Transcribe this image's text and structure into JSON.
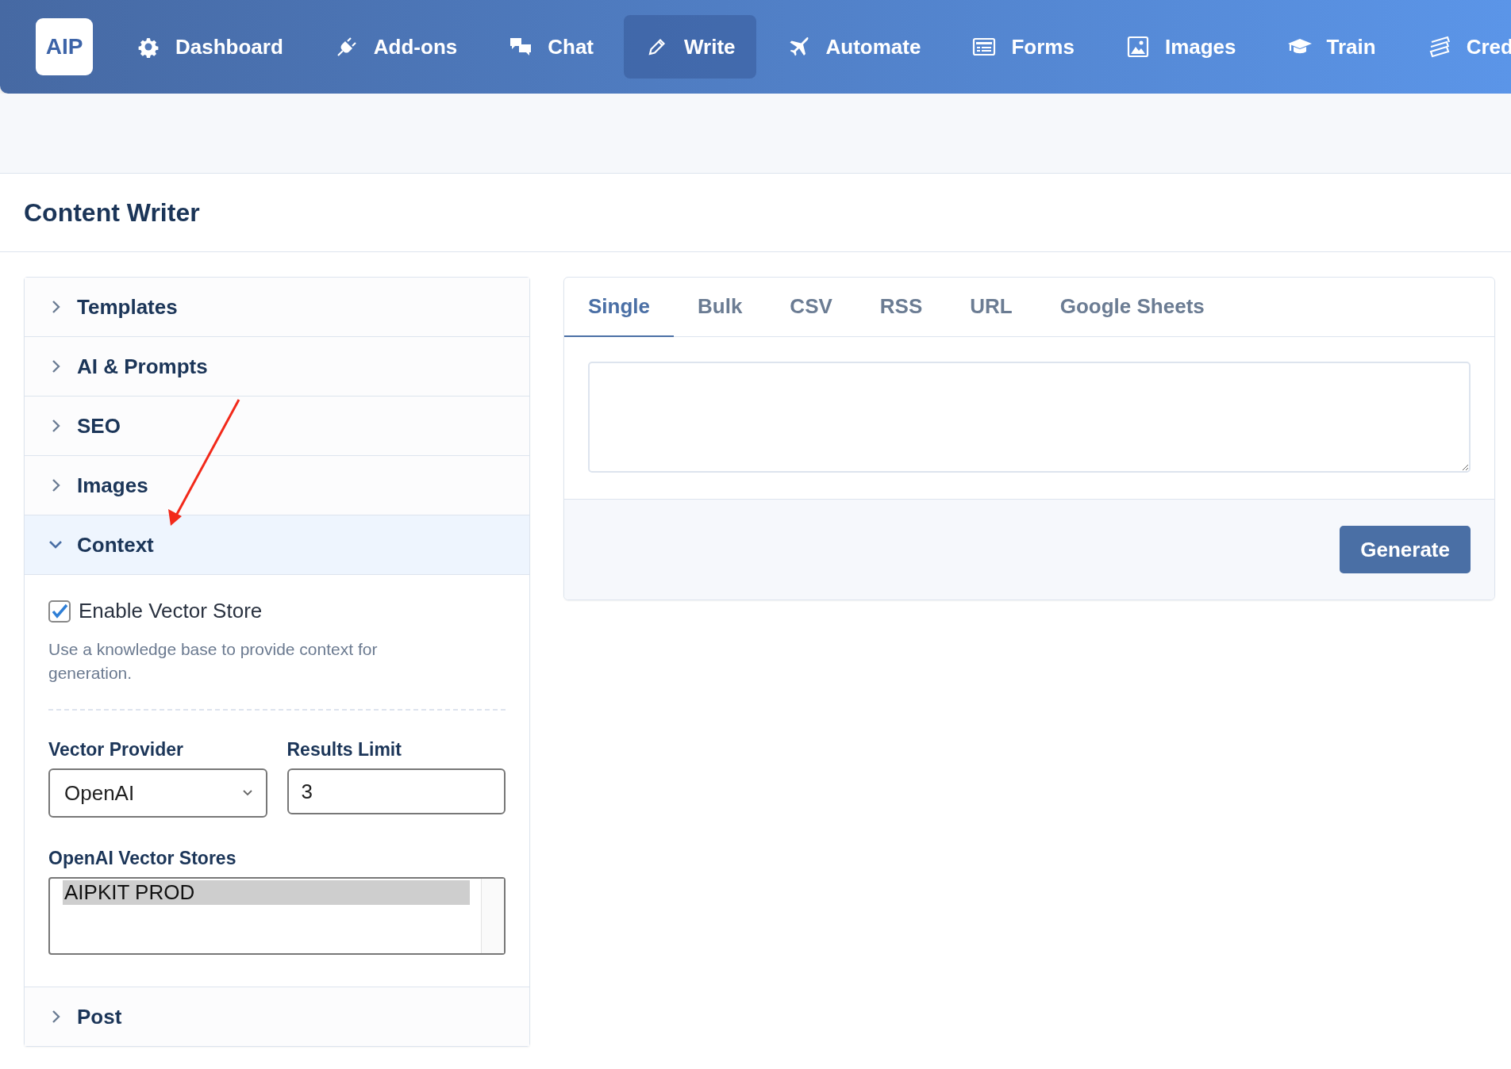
{
  "nav": {
    "logo": "AIP",
    "items": [
      {
        "label": "Dashboard",
        "selected": false
      },
      {
        "label": "Add-ons",
        "selected": false
      },
      {
        "label": "Chat",
        "selected": false
      },
      {
        "label": "Write",
        "selected": true
      },
      {
        "label": "Automate",
        "selected": false
      },
      {
        "label": "Forms",
        "selected": false
      },
      {
        "label": "Images",
        "selected": false
      },
      {
        "label": "Train",
        "selected": false
      },
      {
        "label": "Cred",
        "selected": false
      }
    ]
  },
  "page_title": "Content Writer",
  "accordion": [
    {
      "label": "Templates",
      "expanded": false
    },
    {
      "label": "AI & Prompts",
      "expanded": false
    },
    {
      "label": "SEO",
      "expanded": false
    },
    {
      "label": "Images",
      "expanded": false
    },
    {
      "label": "Context",
      "expanded": true
    },
    {
      "label": "Post",
      "expanded": false
    }
  ],
  "context": {
    "checkbox": {
      "label": "Enable Vector Store",
      "checked": true
    },
    "help": "Use a knowledge base to provide context for generation.",
    "provider": {
      "label": "Vector Provider",
      "value": "OpenAI"
    },
    "limit": {
      "label": "Results Limit",
      "value": "3"
    },
    "stores": {
      "label": "OpenAI Vector Stores",
      "options": [
        {
          "label": "AIPKIT PROD",
          "selected": true
        }
      ]
    }
  },
  "tabs": [
    {
      "label": "Single",
      "selected": true
    },
    {
      "label": "Bulk",
      "selected": false
    },
    {
      "label": "CSV",
      "selected": false
    },
    {
      "label": "RSS",
      "selected": false
    },
    {
      "label": "URL",
      "selected": false
    },
    {
      "label": "Google Sheets",
      "selected": false
    }
  ],
  "generate_button": "Generate"
}
